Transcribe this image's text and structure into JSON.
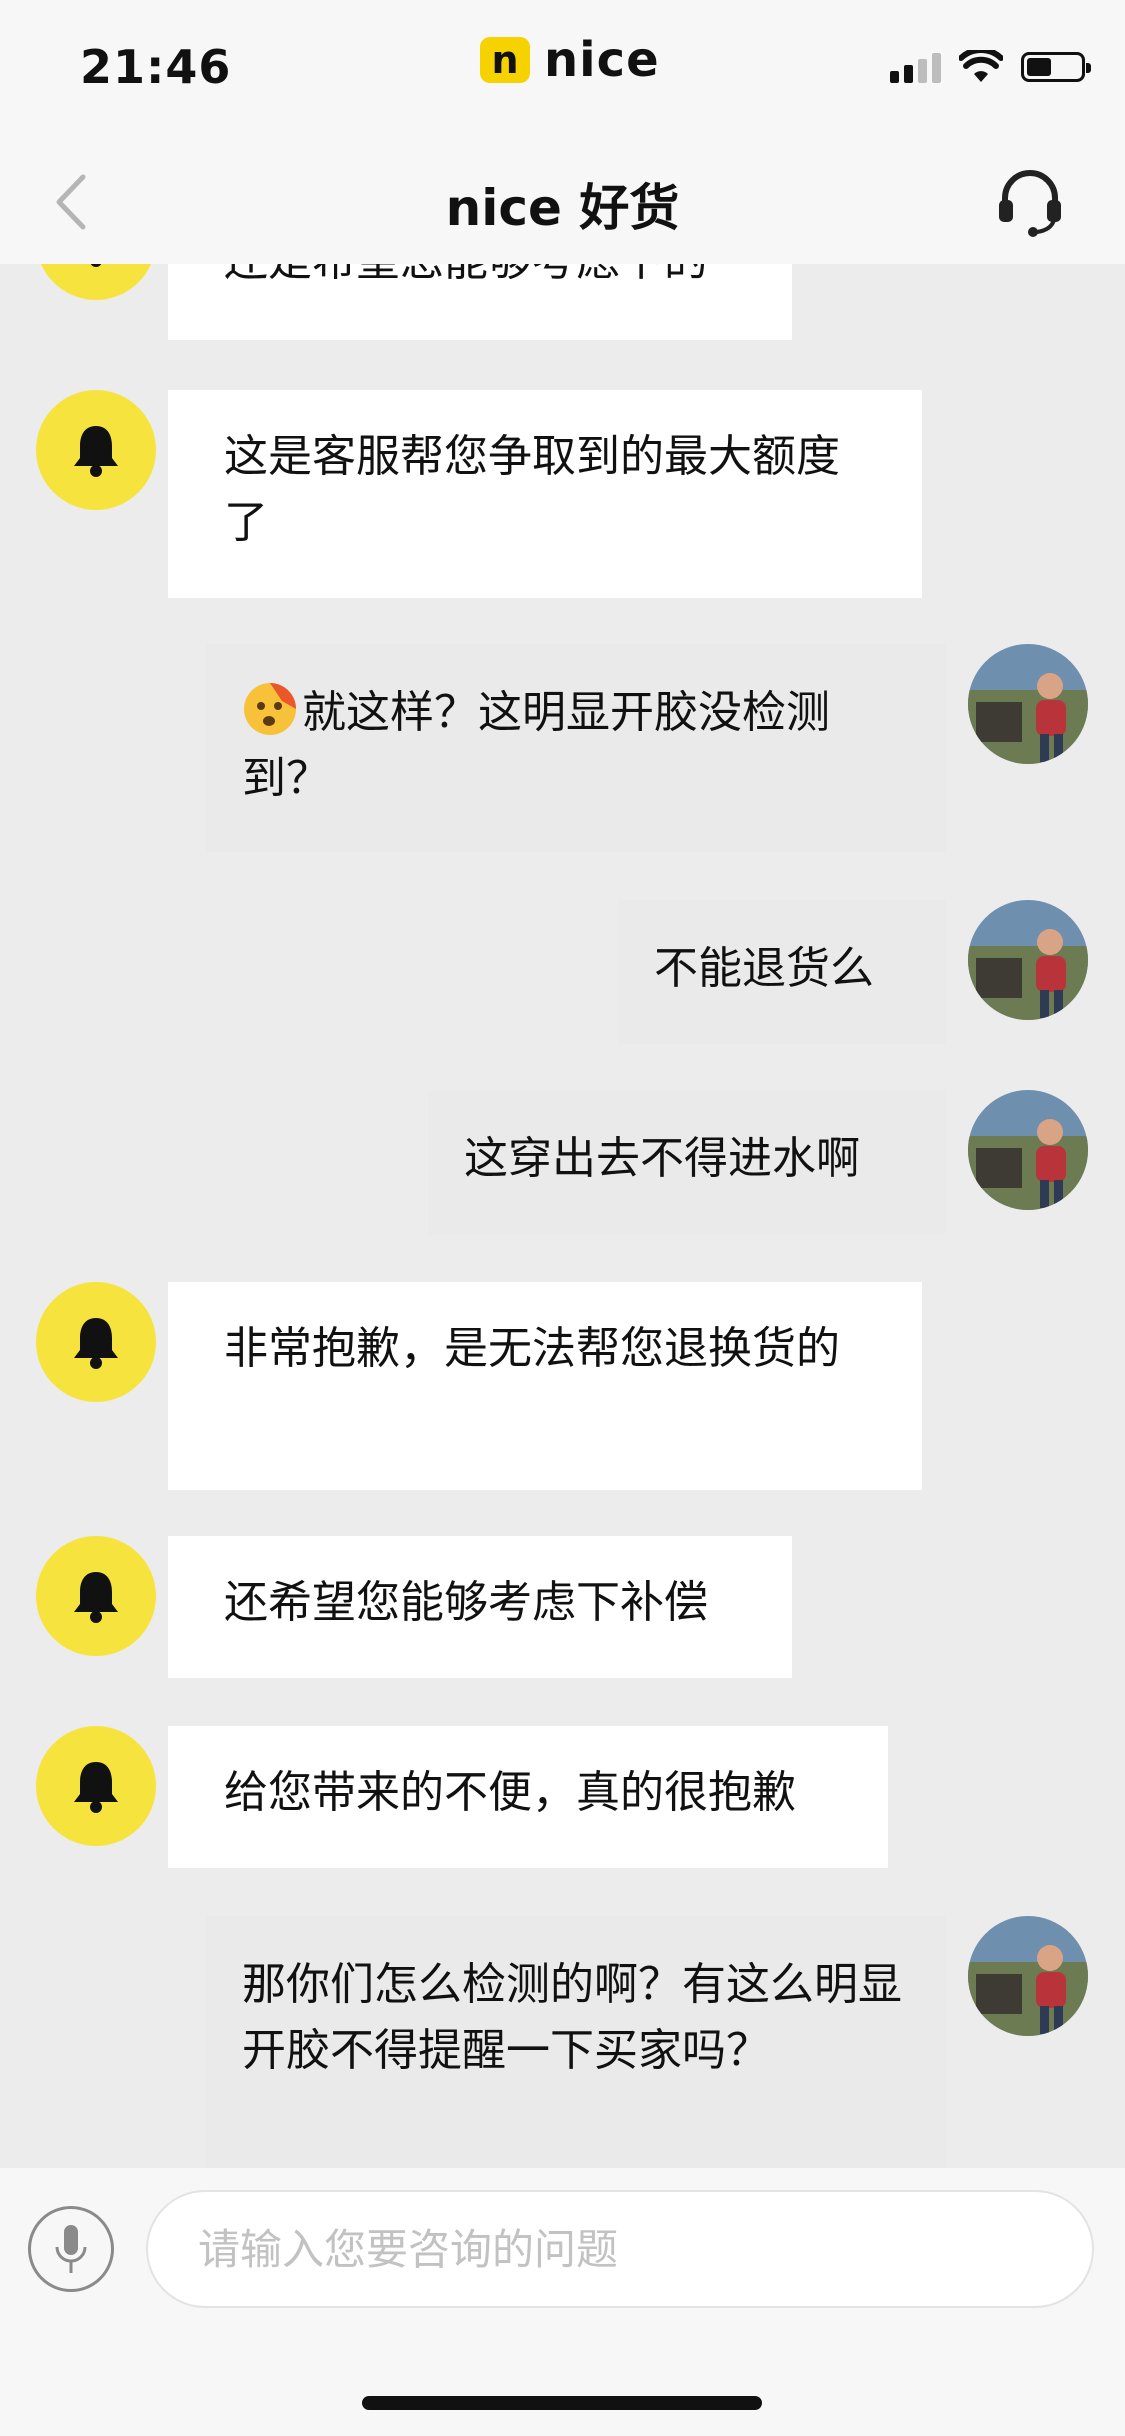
{
  "status_bar": {
    "time": "21:46",
    "logo_badge": "n",
    "logo_text": "nice"
  },
  "header": {
    "title": "nice 好货"
  },
  "messages": [
    {
      "from": "agent",
      "text": "还是希望您能够考虑下的"
    },
    {
      "from": "agent",
      "text": "这是客服帮您争取到的最大额度了"
    },
    {
      "from": "user",
      "text": "就这样？这明显开胶没检测到？",
      "emoji": "dizzy-face"
    },
    {
      "from": "user",
      "text": "不能退货么"
    },
    {
      "from": "user",
      "text": "这穿出去不得进水啊"
    },
    {
      "from": "agent",
      "text": "非常抱歉，是无法帮您退换货的"
    },
    {
      "from": "agent",
      "text": "还希望您能够考虑下补偿"
    },
    {
      "from": "agent",
      "text": "给您带来的不便，真的很抱歉"
    },
    {
      "from": "user",
      "text": "那你们怎么检测的啊？有这么明显开胶不得提醒一下买家吗？"
    }
  ],
  "input": {
    "placeholder": "请输入您要咨询的问题",
    "value": ""
  },
  "colors": {
    "accent": "#f6e33d",
    "agent_bubble": "#ffffff",
    "user_bubble": "#eaeaea",
    "background": "#ececec"
  }
}
